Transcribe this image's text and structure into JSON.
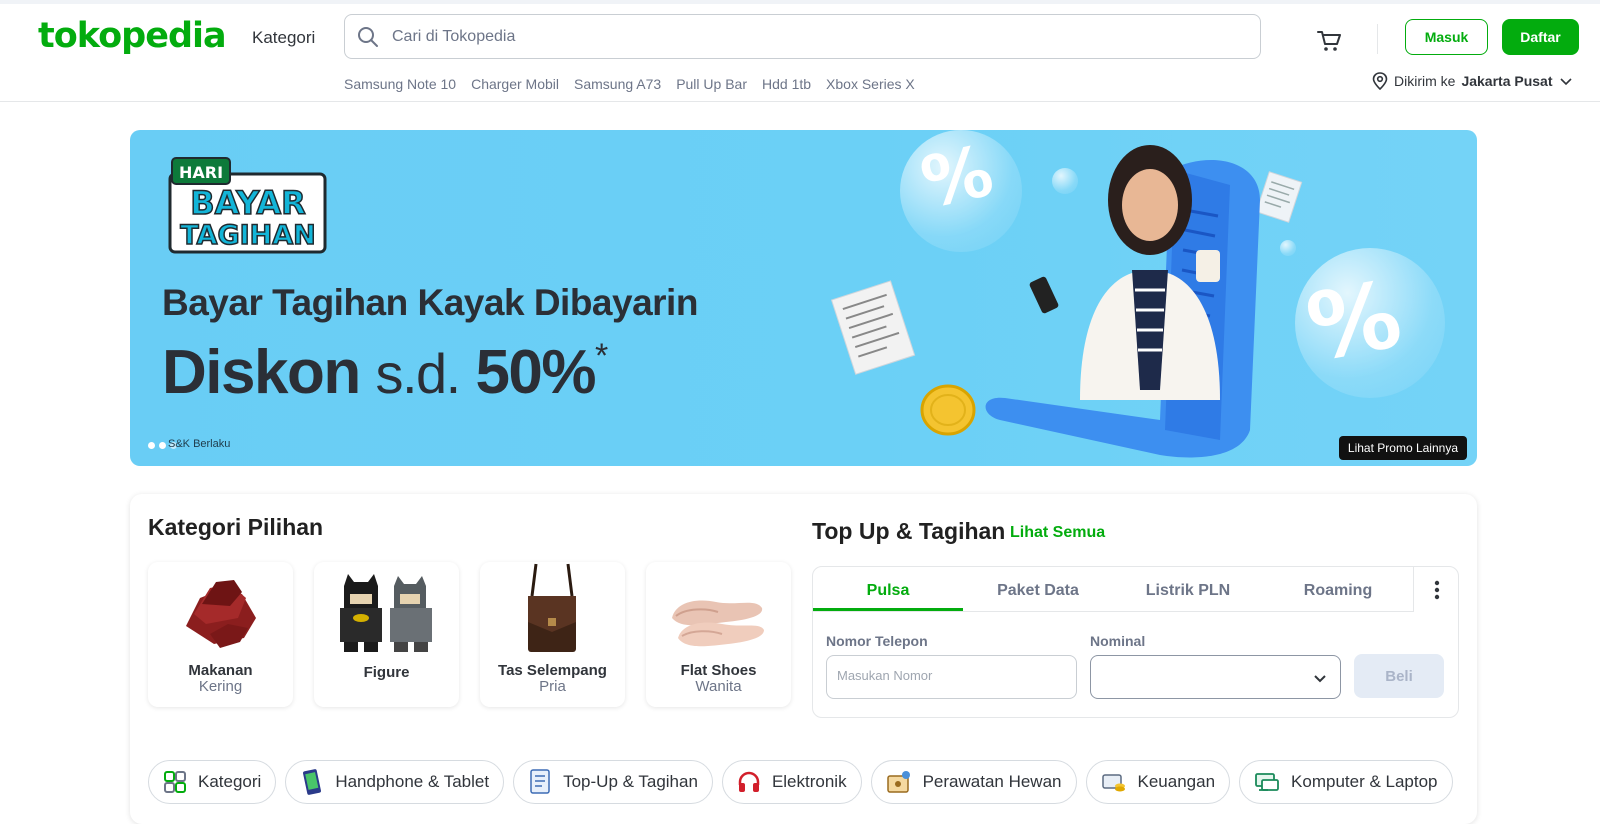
{
  "header": {
    "logo": "tokopedia",
    "kategori": "Kategori",
    "search_placeholder": "Cari di Tokopedia",
    "quick_links": [
      "Samsung Note 10",
      "Charger Mobil",
      "Samsung A73",
      "Pull Up Bar",
      "Hdd 1tb",
      "Xbox Series X"
    ],
    "masuk": "Masuk",
    "daftar": "Daftar",
    "location_prefix": "Dikirim ke",
    "location_city": "Jakarta Pusat"
  },
  "banner": {
    "badge_line1": "HARI",
    "badge_line2": "BAYAR",
    "badge_line3": "TAGIHAN",
    "title": "Bayar Tagihan Kayak Dibayarin",
    "diskon": "Diskon",
    "sd": "s.d.",
    "percent": "50%",
    "asterisk": "*",
    "snk": "S&K Berlaku",
    "promo_button": "Lihat Promo Lainnya",
    "bg_color": "#69cdf5"
  },
  "kategori_pilihan": {
    "title": "Kategori Pilihan",
    "items": [
      {
        "line1": "Makanan",
        "line2": "Kering"
      },
      {
        "line1": "Figure",
        "line2": ""
      },
      {
        "line1": "Tas Selempang",
        "line2": "Pria"
      },
      {
        "line1": "Flat Shoes",
        "line2": "Wanita"
      }
    ]
  },
  "topup": {
    "title": "Top Up & Tagihan",
    "lihat_semua": "Lihat Semua",
    "tabs": [
      "Pulsa",
      "Paket Data",
      "Listrik PLN",
      "Roaming"
    ],
    "active_tab": "Pulsa",
    "phone_label": "Nomor Telepon",
    "phone_placeholder": "Masukan Nomor",
    "nominal_label": "Nominal",
    "nominal_value": "",
    "beli": "Beli"
  },
  "category_chips": [
    {
      "label": "Kategori",
      "icon": "category-grid-icon"
    },
    {
      "label": "Handphone & Tablet",
      "icon": "phone-icon"
    },
    {
      "label": "Top-Up & Tagihan",
      "icon": "bill-icon"
    },
    {
      "label": "Elektronik",
      "icon": "headphones-icon"
    },
    {
      "label": "Perawatan Hewan",
      "icon": "pet-care-icon"
    },
    {
      "label": "Keuangan",
      "icon": "finance-icon"
    },
    {
      "label": "Komputer & Laptop",
      "icon": "computer-icon"
    }
  ],
  "colors": {
    "brand_green": "#03ac0e",
    "text_dark": "#31353b",
    "text_muted": "#6d7588"
  }
}
